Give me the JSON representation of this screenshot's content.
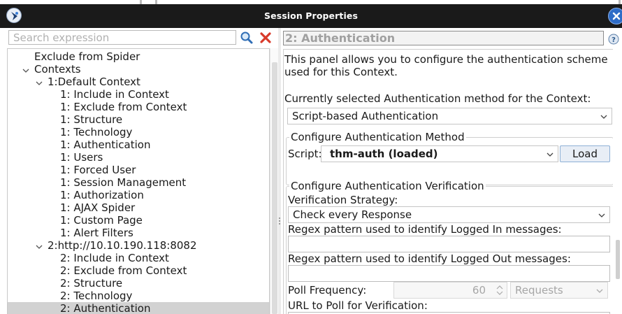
{
  "window": {
    "title": "Session Properties"
  },
  "search": {
    "placeholder": "Search expression",
    "value": ""
  },
  "tree": {
    "items": [
      {
        "label": "Exclude from Spider"
      },
      {
        "label": "Contexts"
      },
      {
        "label": "1:Default Context"
      },
      {
        "label": "1: Include in Context"
      },
      {
        "label": "1: Exclude from Context"
      },
      {
        "label": "1: Structure"
      },
      {
        "label": "1: Technology"
      },
      {
        "label": "1: Authentication"
      },
      {
        "label": "1: Users"
      },
      {
        "label": "1: Forced User"
      },
      {
        "label": "1: Session Management"
      },
      {
        "label": "1: Authorization"
      },
      {
        "label": "1: AJAX Spider"
      },
      {
        "label": "1: Custom Page"
      },
      {
        "label": "1: Alert Filters"
      },
      {
        "label": "2:http://10.10.190.118:8082"
      },
      {
        "label": "2: Include in Context"
      },
      {
        "label": "2: Exclude from Context"
      },
      {
        "label": "2: Structure"
      },
      {
        "label": "2: Technology"
      },
      {
        "label": "2: Authentication"
      }
    ]
  },
  "panel": {
    "header": "2: Authentication",
    "description_line1": "This panel allows you to configure the authentication scheme",
    "description_line2": "used for this Context.",
    "method_label": "Currently selected Authentication method for the Context:",
    "method_value": "Script-based Authentication",
    "configure_method": {
      "title": "Configure Authentication Method",
      "script_label": "Script:",
      "script_value": "thm-auth (loaded)",
      "load_button": "Load"
    },
    "verification": {
      "title": "Configure Authentication Verification",
      "strategy_label": "Verification Strategy:",
      "strategy_value": "Check every Response",
      "logged_in_label": "Regex pattern used to identify Logged In messages:",
      "logged_in_value": "",
      "logged_out_label": "Regex pattern used to identify Logged Out messages:",
      "logged_out_value": "",
      "poll_label": "Poll Frequency:",
      "poll_value": "60",
      "poll_unit": "Requests",
      "url_label": "URL to Poll for Verification:"
    }
  }
}
